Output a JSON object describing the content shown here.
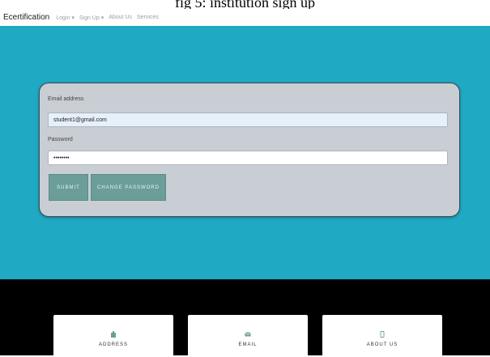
{
  "caption": "fig 5: institution sign up",
  "navbar": {
    "brand": "Ecertification",
    "links": [
      "Login ▾",
      "Sign Up ▾",
      "About Us",
      "Services"
    ]
  },
  "form": {
    "email_label": "Email address",
    "email_value": "student1@gmail.com",
    "password_label": "Password",
    "password_value": "••••••••",
    "submit_label": "SUBMIT",
    "change_password_label": "CHANGE PASSWORD"
  },
  "footer": {
    "cards": [
      {
        "label": "ADDRESS",
        "icon": "building-icon"
      },
      {
        "label": "EMAIL",
        "icon": "envelope-icon"
      },
      {
        "label": "ABOUT US",
        "icon": "phone-icon"
      }
    ]
  },
  "colors": {
    "hero": "#1fa9c2",
    "button": "#6b9e98",
    "card": "#c9ced4",
    "footer": "#000000"
  }
}
